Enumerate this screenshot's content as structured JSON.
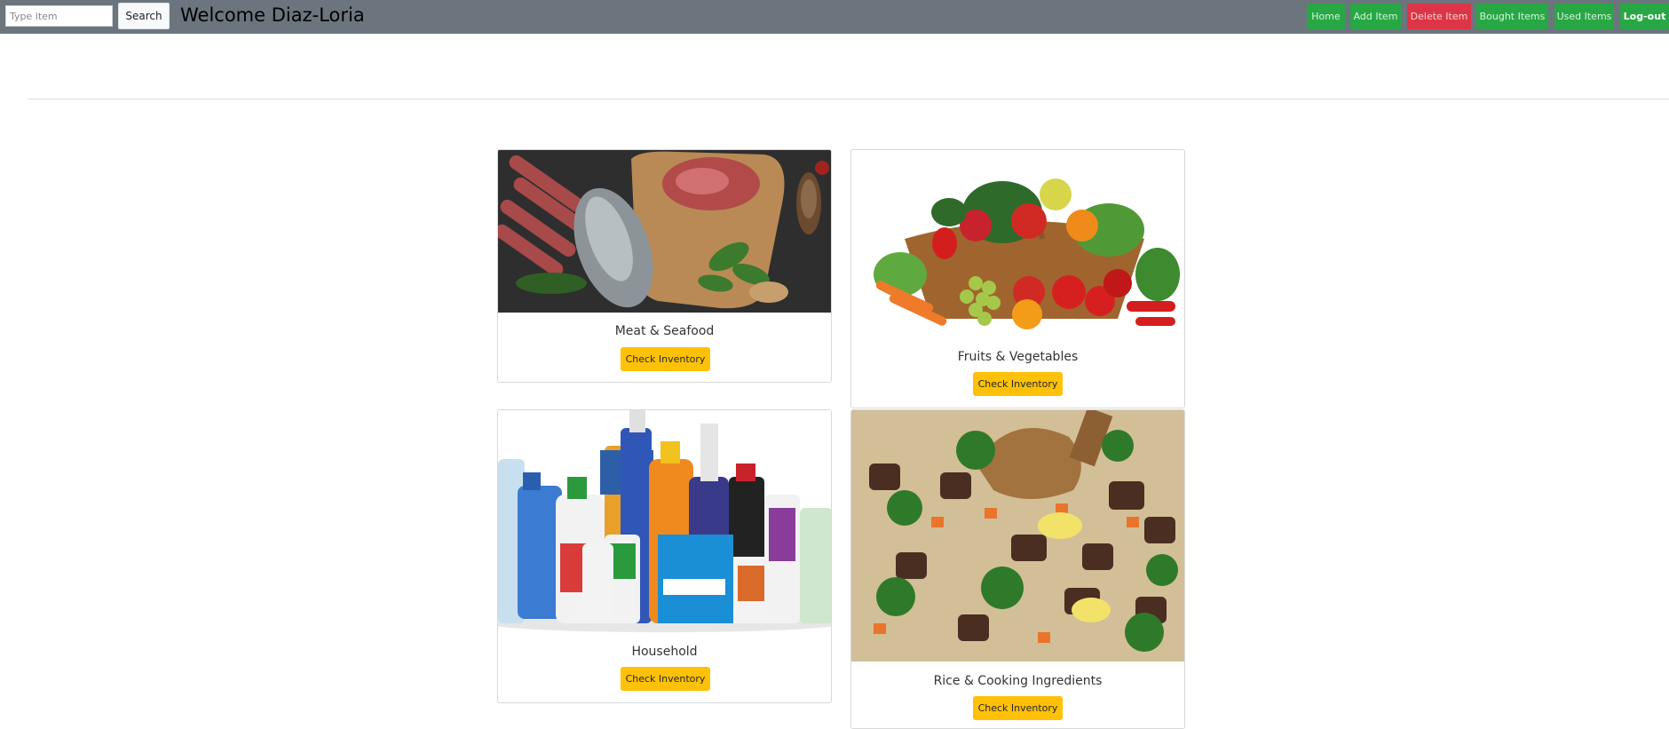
{
  "header": {
    "search_placeholder": "Type item",
    "search_label": "Search",
    "welcome_text": "Welcome Diaz-Loria"
  },
  "nav": {
    "home": "Home",
    "add_item": "Add Item",
    "delete_item": "Delete Item",
    "bought_items": "Bought Items",
    "used_items": "Used Items",
    "logout": "Log-out"
  },
  "categories": [
    {
      "title": "Meat & Seafood",
      "button": "Check Inventory"
    },
    {
      "title": "Fruits & Vegetables",
      "button": "Check Inventory"
    },
    {
      "title": "Household",
      "button": "Check Inventory"
    },
    {
      "title": "Rice & Cooking Ingredients",
      "button": "Check Inventory"
    }
  ],
  "colors": {
    "navbar": "#6c757d",
    "success": "#28a745",
    "danger": "#dc3545",
    "warning": "#ffc107"
  }
}
